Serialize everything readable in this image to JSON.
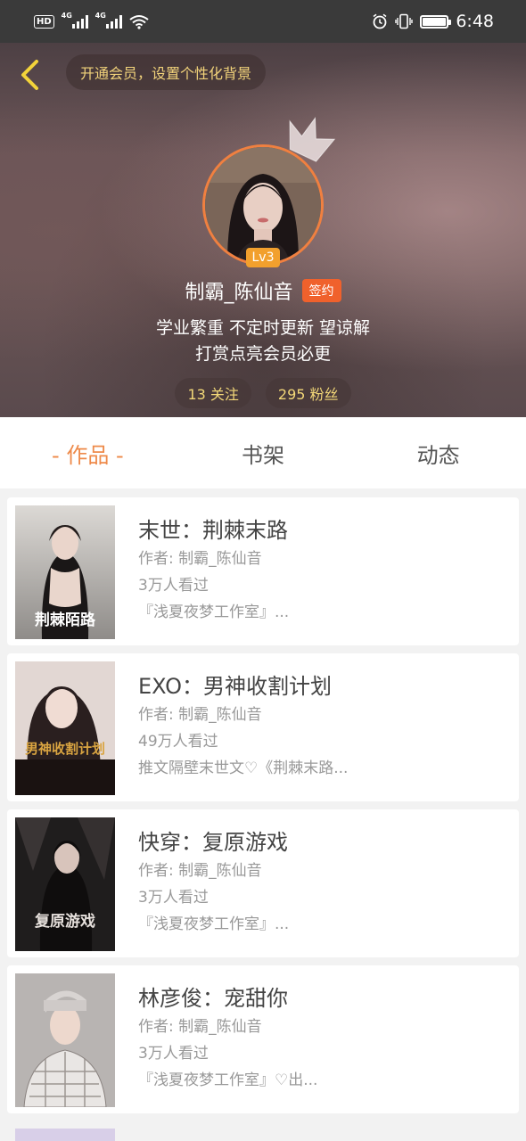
{
  "status_bar": {
    "hd": "HD",
    "net1": "4G",
    "net2": "4G",
    "time": "6:48"
  },
  "header": {
    "vip_text": "开通会员，设置个性化背景",
    "level": "Lv3",
    "name": "制霸_陈仙音",
    "sign_badge": "签约",
    "bio_line1": "学业繁重 不定时更新 望谅解",
    "bio_line2": "打赏点亮会员必更",
    "following": "13 关注",
    "fans": "295 粉丝"
  },
  "tabs": [
    {
      "label": "- 作品 -"
    },
    {
      "label": "书架"
    },
    {
      "label": "动态"
    }
  ],
  "books": [
    {
      "title": "末世：荆棘末路",
      "author": "作者: 制霸_陈仙音",
      "views": "3万人看过",
      "desc": "『浅夏夜梦工作室』...",
      "cover_text": "荆棘陌路"
    },
    {
      "title": "EXO：男神收割计划",
      "author": "作者: 制霸_陈仙音",
      "views": "49万人看过",
      "desc": "推文隔壁末世文♡《荆棘末路...",
      "cover_text": "男神收割计划"
    },
    {
      "title": "快穿：复原游戏",
      "author": "作者: 制霸_陈仙音",
      "views": "3万人看过",
      "desc": "『浅夏夜梦工作室』...",
      "cover_text": "复原游戏"
    },
    {
      "title": "林彦俊：宠甜你",
      "author": "作者: 制霸_陈仙音",
      "views": "3万人看过",
      "desc": "『浅夏夜梦工作室』♡出...",
      "cover_text": ""
    }
  ],
  "colors": {
    "accent": "#ee8a4a",
    "level_badge": "#f2a02d",
    "sign_badge": "#f0612c",
    "gold_text": "#f3d878"
  }
}
